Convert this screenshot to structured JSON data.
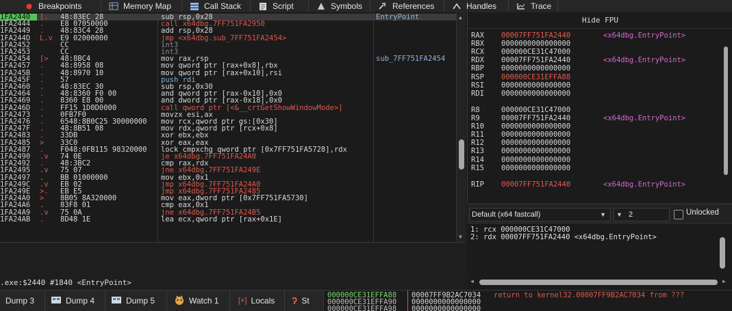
{
  "top_tabs": [
    {
      "label": "Breakpoints",
      "icon": "breakpoint-icon"
    },
    {
      "label": "Memory Map",
      "icon": "memory-map-icon"
    },
    {
      "label": "Call Stack",
      "icon": "call-stack-icon"
    },
    {
      "label": "Script",
      "icon": "script-icon"
    },
    {
      "label": "Symbols",
      "icon": "symbols-icon"
    },
    {
      "label": "References",
      "icon": "references-icon"
    },
    {
      "label": "Handles",
      "icon": "handles-icon"
    },
    {
      "label": "Trace",
      "icon": "trace-icon"
    }
  ],
  "disassembly": {
    "rows": [
      {
        "addr": "1FA2440",
        "gutter": "[.",
        "bytes": "48:83EC 28",
        "instr": "sub rsp,0x28",
        "comment": "EntryPoint",
        "current": true
      },
      {
        "addr": "1FA2444",
        "gutter": ".",
        "bytes": "E8 07050000",
        "instr": "call x64dbg.7FF751FA2950",
        "comment": ""
      },
      {
        "addr": "1FA2449",
        "gutter": ".",
        "bytes": "48:83C4 28",
        "instr": "add rsp,0x28",
        "comment": ""
      },
      {
        "addr": "1FA244D",
        "gutter": "L.v",
        "bytes": "E9 02000000",
        "instr": "jmp <x64dbg.sub_7FF751FA2454>",
        "comment": ""
      },
      {
        "addr": "1FA2452",
        "gutter": "",
        "bytes": "CC",
        "instr": "int3",
        "comment": ""
      },
      {
        "addr": "1FA2453",
        "gutter": "",
        "bytes": "CC",
        "instr": "int3",
        "comment": ""
      },
      {
        "addr": "1FA2454",
        "gutter": "[>",
        "bytes": "48:8BC4",
        "instr": "mov rax,rsp",
        "comment": "sub_7FF751FA2454"
      },
      {
        "addr": "1FA2457",
        "gutter": ".",
        "bytes": "48:8958 08",
        "instr": "mov qword ptr [rax+0x8],rbx",
        "comment": ""
      },
      {
        "addr": "1FA245B",
        "gutter": ".",
        "bytes": "48:8970 10",
        "instr": "mov qword ptr [rax+0x10],rsi",
        "comment": ""
      },
      {
        "addr": "1FA245F",
        "gutter": ".",
        "bytes": "57",
        "instr": "push rdi",
        "comment": ""
      },
      {
        "addr": "1FA2460",
        "gutter": ".",
        "bytes": "48:83EC 30",
        "instr": "sub rsp,0x30",
        "comment": ""
      },
      {
        "addr": "1FA2464",
        "gutter": ".",
        "bytes": "48:8360 F0 00",
        "instr": "and qword ptr [rax-0x10],0x0",
        "comment": ""
      },
      {
        "addr": "1FA2469",
        "gutter": ".",
        "bytes": "8360 E8 00",
        "instr": "and dword ptr [rax-0x18],0x0",
        "comment": ""
      },
      {
        "addr": "1FA246D",
        "gutter": ".",
        "bytes": "FF15 1D0D0000",
        "instr": "call qword ptr [<&__crtGetShowWindowMode>]",
        "comment": ""
      },
      {
        "addr": "1FA2473",
        "gutter": ".",
        "bytes": "0FB7F0",
        "instr": "movzx esi,ax",
        "comment": ""
      },
      {
        "addr": "1FA2476",
        "gutter": ".",
        "bytes": "6548:8B0C25 30000000",
        "instr": "mov rcx,qword ptr gs:[0x30]",
        "comment": ""
      },
      {
        "addr": "1FA247F",
        "gutter": ".",
        "bytes": "48:8B51 08",
        "instr": "mov rdx,qword ptr [rcx+0x8]",
        "comment": ""
      },
      {
        "addr": "1FA2483",
        "gutter": ".",
        "bytes": "33DB",
        "instr": "xor ebx,ebx",
        "comment": ""
      },
      {
        "addr": "1FA2485",
        "gutter": ">",
        "bytes": "33C0",
        "instr": "xor eax,eax",
        "comment": ""
      },
      {
        "addr": "1FA2487",
        "gutter": ".",
        "bytes": "F048:0FB115 98320000",
        "instr": "lock cmpxchg qword ptr [0x7FF751FA5728],rdx",
        "comment": ""
      },
      {
        "addr": "1FA2490",
        "gutter": ".v",
        "bytes": "74 0E",
        "instr": "je x64dbg.7FF751FA24A0",
        "comment": ""
      },
      {
        "addr": "1FA2492",
        "gutter": ".",
        "bytes": "48:3BC2",
        "instr": "cmp rax,rdx",
        "comment": ""
      },
      {
        "addr": "1FA2495",
        "gutter": ".v",
        "bytes": "75 07",
        "instr": "jne x64dbg.7FF751FA249E",
        "comment": ""
      },
      {
        "addr": "1FA2497",
        "gutter": ".",
        "bytes": "BB 01000000",
        "instr": "mov ebx,0x1",
        "comment": ""
      },
      {
        "addr": "1FA249C",
        "gutter": ".v",
        "bytes": "EB 02",
        "instr": "jmp x64dbg.7FF751FA24A0",
        "comment": ""
      },
      {
        "addr": "1FA249E",
        "gutter": ">.",
        "bytes": "EB E5",
        "instr": "jmp x64dbg.7FF751FA2485",
        "comment": ""
      },
      {
        "addr": "1FA24A0",
        "gutter": ">",
        "bytes": "8B05 8A320000",
        "instr": "mov eax,dword ptr [0x7FF751FA5730]",
        "comment": ""
      },
      {
        "addr": "1FA24A6",
        "gutter": ".",
        "bytes": "83F8 01",
        "instr": "cmp eax,0x1",
        "comment": ""
      },
      {
        "addr": "1FA24A9",
        "gutter": ".v",
        "bytes": "75 0A",
        "instr": "jne x64dbg.7FF751FA24B5",
        "comment": ""
      },
      {
        "addr": "1FA24AB",
        "gutter": ".",
        "bytes": "8D48 1E",
        "instr": "lea ecx,qword ptr [rax+0x1E]",
        "comment": ""
      }
    ]
  },
  "info_line": ".exe:$2440 #1840 <EntryPoint>",
  "registers": {
    "header": "Hide FPU",
    "rows": [
      {
        "name": "RAX",
        "value": "00007FF751FA2440",
        "symbol": "<x64dbg.EntryPoint>",
        "modified": true
      },
      {
        "name": "RBX",
        "value": "0000000000000000",
        "symbol": ""
      },
      {
        "name": "RCX",
        "value": "000000CE31C47000",
        "symbol": ""
      },
      {
        "name": "RDX",
        "value": "00007FF751FA2440",
        "symbol": "<x64dbg.EntryPoint>"
      },
      {
        "name": "RBP",
        "value": "0000000000000000",
        "symbol": ""
      },
      {
        "name": "RSP",
        "value": "000000CE31EFFA88",
        "symbol": "",
        "modified": true
      },
      {
        "name": "RSI",
        "value": "0000000000000000",
        "symbol": ""
      },
      {
        "name": "RDI",
        "value": "0000000000000000",
        "symbol": ""
      },
      {
        "name": "",
        "value": "",
        "symbol": ""
      },
      {
        "name": "R8",
        "value": "000000CE31C47000",
        "symbol": ""
      },
      {
        "name": "R9",
        "value": "00007FF751FA2440",
        "symbol": "<x64dbg.EntryPoint>"
      },
      {
        "name": "R10",
        "value": "0000000000000000",
        "symbol": ""
      },
      {
        "name": "R11",
        "value": "0000000000000000",
        "symbol": ""
      },
      {
        "name": "R12",
        "value": "0000000000000000",
        "symbol": ""
      },
      {
        "name": "R13",
        "value": "0000000000000000",
        "symbol": ""
      },
      {
        "name": "R14",
        "value": "0000000000000000",
        "symbol": ""
      },
      {
        "name": "R15",
        "value": "0000000000000000",
        "symbol": ""
      },
      {
        "name": "",
        "value": "",
        "symbol": ""
      },
      {
        "name": "RIP",
        "value": "00007FF751FA2440",
        "symbol": "<x64dbg.EntryPoint>",
        "modified": true
      }
    ]
  },
  "call_convention": {
    "selected": "Default (x64 fastcall)",
    "arg_count": "2",
    "unlocked_label": "Unlocked",
    "unlocked_checked": false,
    "args": [
      "1: rcx 000000CE31C47000",
      "2: rdx 00007FF751FA2440 <x64dbg.EntryPoint>"
    ]
  },
  "bottom_tabs": [
    {
      "label": "Dump 3",
      "icon": ""
    },
    {
      "label": "Dump 4",
      "icon": "dump-icon"
    },
    {
      "label": "Dump 5",
      "icon": "dump-icon"
    },
    {
      "label": "Watch 1",
      "icon": "watch-icon"
    },
    {
      "label": "Locals",
      "icon": "locals-icon"
    },
    {
      "label": "St",
      "icon": "struct-icon"
    }
  ],
  "stack": {
    "rows": [
      {
        "addr": "000000CE31EFFA88",
        "value": "00007FF9B2AC7034",
        "comment": "return to kernel32.00007FF9B2AC7034 from ???",
        "current": true
      },
      {
        "addr": "000000CE31EFFA90",
        "value": "0000000000000000",
        "comment": ""
      },
      {
        "addr": "000000CE31EFFA98",
        "value": "0000000000000000",
        "comment": ""
      }
    ]
  },
  "colors": {
    "background": "#1e1e1e",
    "current_address": "#55c35a",
    "modified_register": "#e05a50",
    "symbol": "#d16ad1",
    "jump_target": "#e0564b"
  }
}
